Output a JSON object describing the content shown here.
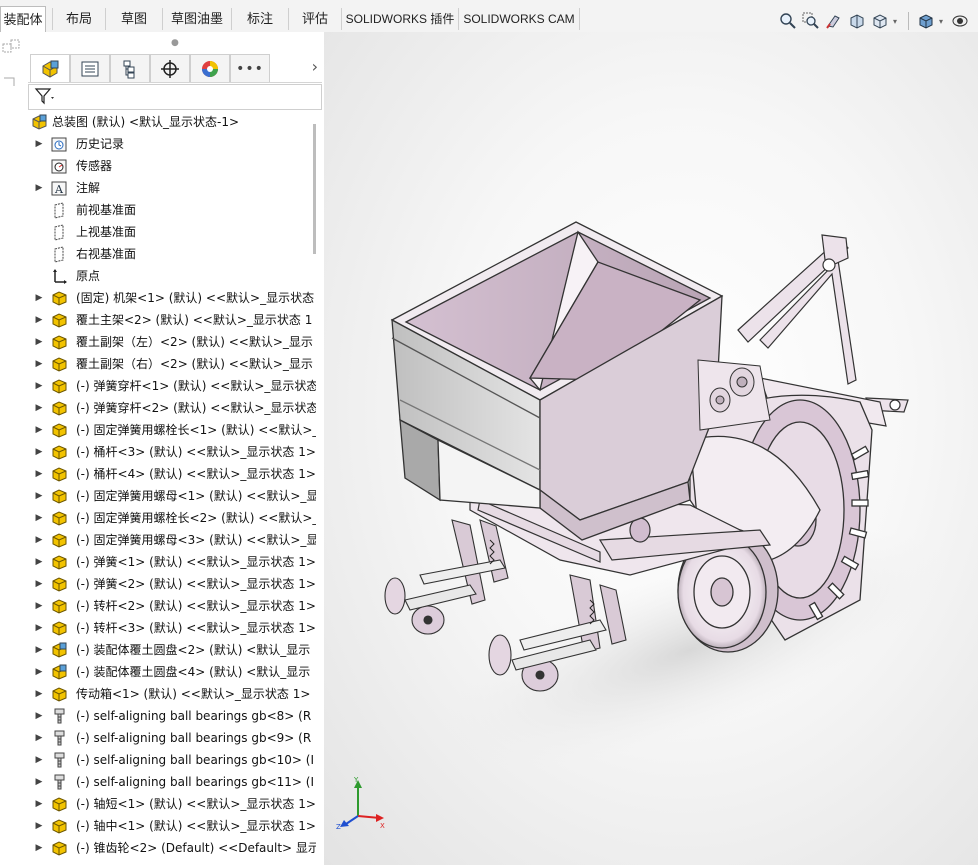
{
  "tabs": [
    {
      "label": "装配体",
      "active": true
    },
    {
      "label": "布局",
      "active": false
    },
    {
      "label": "草图",
      "active": false
    },
    {
      "label": "草图油墨",
      "active": false
    },
    {
      "label": "标注",
      "active": false
    },
    {
      "label": "评估",
      "active": false
    },
    {
      "label": "SOLIDWORKS 插件",
      "active": false
    },
    {
      "label": "SOLIDWORKS CAM",
      "active": false
    }
  ],
  "view_toolbar": {
    "icons": [
      "zoom-to-fit-icon",
      "zoom-to-area-icon",
      "previous-view-icon",
      "section-view-icon",
      "view-orientation-icon",
      "display-style-icon",
      "hide-show-icon"
    ]
  },
  "fm_tabs": [
    "featuremanager-tree-icon",
    "propertymanager-icon",
    "configurationmanager-icon",
    "dimxpertmanager-icon",
    "displaymanager-icon",
    "more-icon"
  ],
  "tree": {
    "root": "总装图 (默认) <默认_显示状态-1>",
    "items": [
      {
        "label": "历史记录",
        "icon": "history",
        "expand": true
      },
      {
        "label": "传感器",
        "icon": "sensor",
        "expand": false
      },
      {
        "label": "注解",
        "icon": "annotation",
        "expand": true
      },
      {
        "label": "前视基准面",
        "icon": "plane",
        "expand": false
      },
      {
        "label": "上视基准面",
        "icon": "plane",
        "expand": false
      },
      {
        "label": "右视基准面",
        "icon": "plane",
        "expand": false
      },
      {
        "label": "原点",
        "icon": "origin",
        "expand": false
      },
      {
        "label": "(固定) 机架<1> (默认) <<默认>_显示状态",
        "icon": "part",
        "expand": true
      },
      {
        "label": "覆土主架<2> (默认) <<默认>_显示状态 1",
        "icon": "part",
        "expand": true
      },
      {
        "label": "覆土副架（左）<2> (默认) <<默认>_显示",
        "icon": "part",
        "expand": true
      },
      {
        "label": "覆土副架（右）<2> (默认) <<默认>_显示",
        "icon": "part",
        "expand": true
      },
      {
        "label": "(-) 弹簧穿杆<1> (默认) <<默认>_显示状态",
        "icon": "part",
        "expand": true
      },
      {
        "label": "(-) 弹簧穿杆<2> (默认) <<默认>_显示状态",
        "icon": "part",
        "expand": true
      },
      {
        "label": "(-) 固定弹簧用螺栓长<1> (默认) <<默认>_",
        "icon": "part",
        "expand": true
      },
      {
        "label": "(-) 桶杆<3> (默认) <<默认>_显示状态 1>",
        "icon": "part",
        "expand": true
      },
      {
        "label": "(-) 桶杆<4> (默认) <<默认>_显示状态 1>",
        "icon": "part",
        "expand": true
      },
      {
        "label": "(-) 固定弹簧用螺母<1> (默认) <<默认>_显",
        "icon": "part",
        "expand": true
      },
      {
        "label": "(-) 固定弹簧用螺栓长<2> (默认) <<默认>_",
        "icon": "part",
        "expand": true
      },
      {
        "label": "(-) 固定弹簧用螺母<3> (默认) <<默认>_显",
        "icon": "part",
        "expand": true
      },
      {
        "label": "(-) 弹簧<1> (默认) <<默认>_显示状态 1>",
        "icon": "part",
        "expand": true
      },
      {
        "label": "(-) 弹簧<2> (默认) <<默认>_显示状态 1>",
        "icon": "part",
        "expand": true
      },
      {
        "label": "(-) 转杆<2> (默认) <<默认>_显示状态 1>",
        "icon": "part",
        "expand": true
      },
      {
        "label": "(-) 转杆<3> (默认) <<默认>_显示状态 1>",
        "icon": "part",
        "expand": true
      },
      {
        "label": "(-) 装配体覆土圆盘<2> (默认) <默认_显示",
        "icon": "subassembly",
        "expand": true
      },
      {
        "label": "(-) 装配体覆土圆盘<4> (默认) <默认_显示",
        "icon": "subassembly",
        "expand": true
      },
      {
        "label": "传动箱<1> (默认) <<默认>_显示状态 1>",
        "icon": "part",
        "expand": true
      },
      {
        "label": "(-) self-aligning ball bearings gb<8> (R",
        "icon": "toolbox",
        "expand": true
      },
      {
        "label": "(-) self-aligning ball bearings gb<9> (R",
        "icon": "toolbox",
        "expand": true
      },
      {
        "label": "(-) self-aligning ball bearings gb<10> (I",
        "icon": "toolbox",
        "expand": true
      },
      {
        "label": "(-) self-aligning ball bearings gb<11> (I",
        "icon": "toolbox",
        "expand": true
      },
      {
        "label": "(-) 轴短<1> (默认) <<默认>_显示状态 1>",
        "icon": "part",
        "expand": true
      },
      {
        "label": "(-) 轴中<1> (默认) <<默认>_显示状态 1>",
        "icon": "part",
        "expand": true
      },
      {
        "label": "(-) 锥齿轮<2> (Default) <<Default> 显示",
        "icon": "part",
        "expand": true
      }
    ]
  },
  "triad": {
    "x": "X",
    "y": "Y",
    "z": "Z"
  },
  "colors": {
    "part_fill": "#d9c6d6",
    "part_edge": "#3a3a3a",
    "part_yellow": "#f2c300",
    "subasm_blue": "#5aa0d8"
  }
}
